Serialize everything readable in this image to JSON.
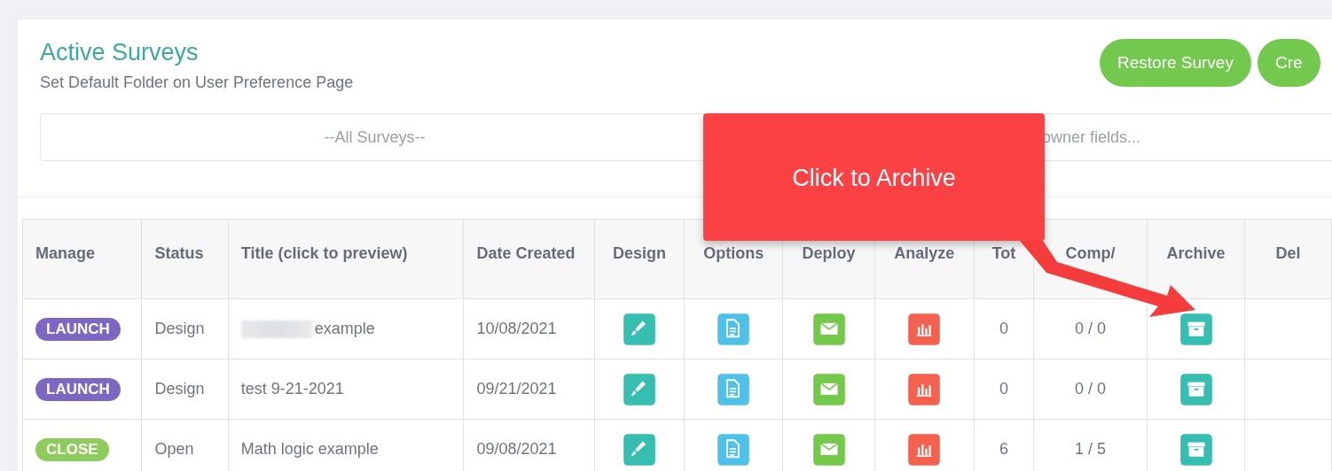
{
  "header": {
    "title": "Active Surveys",
    "subtitle": "Set Default Folder on User Preference Page"
  },
  "buttons": [
    "Restore Survey",
    "Cre"
  ],
  "filters": {
    "folder": "--All Surveys--",
    "search_placeholder": "owner fields..."
  },
  "callout": {
    "text": "Click to Archive"
  },
  "table": {
    "columns": [
      "Manage",
      "Status",
      "Title (click to preview)",
      "Date Created",
      "Design",
      "Options",
      "Deploy",
      "Analyze",
      "Tot",
      "Comp/",
      "Archive",
      "Del"
    ],
    "rows": [
      {
        "manage": {
          "label": "LAUNCH",
          "kind": "launch"
        },
        "status": "Design",
        "title": "example",
        "redacted": true,
        "date": "10/08/2021",
        "total": "0",
        "comp": "0 / 0"
      },
      {
        "manage": {
          "label": "LAUNCH",
          "kind": "launch"
        },
        "status": "Design",
        "title": "test 9-21-2021",
        "redacted": false,
        "date": "09/21/2021",
        "total": "0",
        "comp": "0 / 0"
      },
      {
        "manage": {
          "label": "CLOSE",
          "kind": "close"
        },
        "status": "Open",
        "title": "Math logic example",
        "redacted": false,
        "date": "09/08/2021",
        "total": "6",
        "comp": "1 / 5"
      }
    ]
  }
}
